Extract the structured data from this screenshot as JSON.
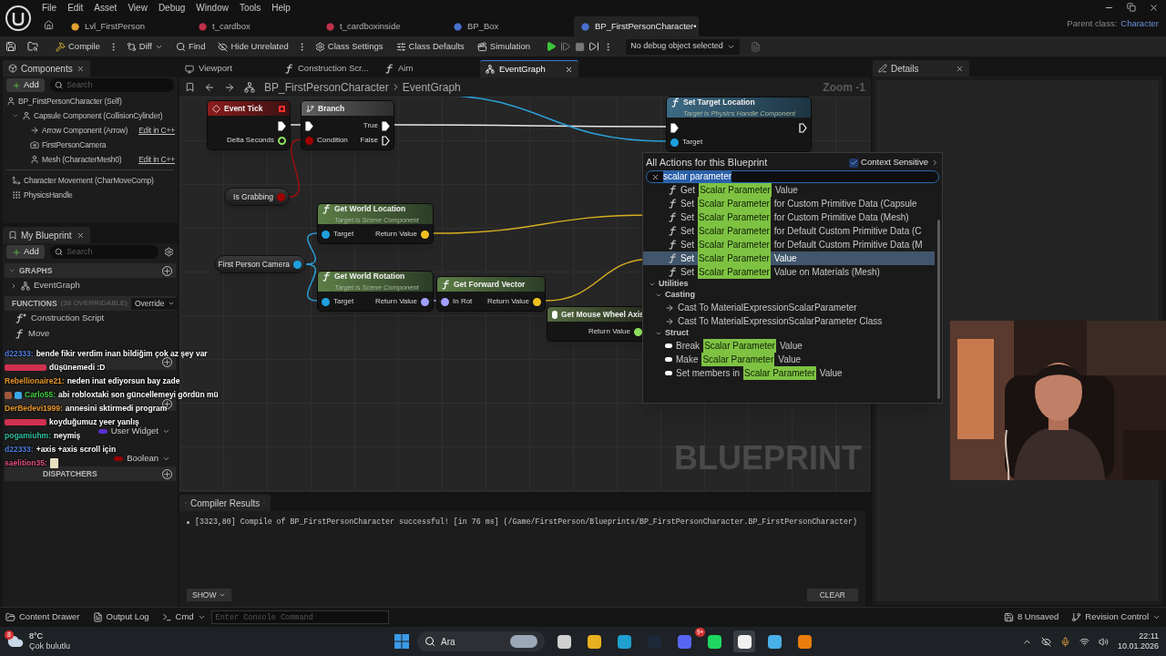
{
  "window": {
    "menu": [
      "File",
      "Edit",
      "Asset",
      "View",
      "Debug",
      "Window",
      "Tools",
      "Help"
    ],
    "tabs": [
      {
        "label": "Lvl_FirstPerson",
        "kind": "level",
        "selected": false
      },
      {
        "label": "t_cardbox",
        "kind": "texture",
        "selected": false
      },
      {
        "label": "t_cardboxinside",
        "kind": "texture",
        "selected": false
      },
      {
        "label": "BP_Box",
        "kind": "blueprint",
        "selected": false
      },
      {
        "label": "BP_FirstPersonCharacter•",
        "kind": "blueprint",
        "selected": true
      }
    ],
    "parent_class_label": "Parent class:",
    "parent_class": "Character"
  },
  "toolbar": [
    {
      "kind": "compile",
      "label": "Compile"
    },
    {
      "kind": "diff",
      "label": "Diff"
    },
    {
      "kind": "find",
      "label": "Find"
    },
    {
      "kind": "hide",
      "label": "Hide Unrelated"
    },
    {
      "kind": "settings",
      "label": "Class Settings"
    },
    {
      "kind": "defaults",
      "label": "Class Defaults"
    },
    {
      "kind": "simulation",
      "label": "Simulation"
    }
  ],
  "debug_object": "No debug object selected",
  "editor_tabs": [
    {
      "label": "Viewport",
      "kind": "viewport",
      "selected": false
    },
    {
      "label": "Construction Scr...",
      "kind": "function",
      "selected": false
    },
    {
      "label": "Aim",
      "kind": "function",
      "selected": false
    },
    {
      "label": "EventGraph",
      "kind": "graph",
      "selected": true
    }
  ],
  "components": {
    "title": "Components",
    "add": "Add",
    "search_placeholder": "Search",
    "tree": [
      {
        "label": "BP_FirstPersonCharacter (Self)",
        "kind": "self",
        "children": [
          {
            "label": "Capsule Component (CollisionCylinder)",
            "kind": "capsule",
            "children": [
              {
                "label": "Arrow Component (Arrow)",
                "kind": "arrow",
                "link": "Edit in C++"
              },
              {
                "label": "FirstPersonCamera",
                "kind": "camera"
              },
              {
                "label": "Mesh (CharacterMesh0)",
                "kind": "mesh",
                "link": "Edit in C++"
              }
            ]
          }
        ]
      }
    ],
    "other": [
      {
        "label": "Character Movement (CharMoveComp)",
        "kind": "movement"
      },
      {
        "label": "PhysicsHandle",
        "kind": "handle"
      }
    ]
  },
  "my_blueprint": {
    "title": "My Blueprint",
    "add": "Add",
    "search_placeholder": "Search",
    "graphs": {
      "title": "GRAPHS",
      "items": [
        "EventGraph"
      ]
    },
    "functions": {
      "title": "FUNCTIONS",
      "note": "(38 OVERRIDABLE)",
      "override": "Override",
      "items": [
        {
          "label": "Construction Script",
          "kind": "construction"
        },
        {
          "label": "Move",
          "kind": "function"
        }
      ]
    },
    "variables": [
      {
        "type": "User Widget",
        "color": "#5a2fd0"
      },
      {
        "type": "Boolean",
        "color": "#950000"
      }
    ],
    "dispatchers_title": "DISPATCHERS"
  },
  "graph": {
    "breadcrumb": [
      "BP_FirstPersonCharacter",
      "EventGraph"
    ],
    "zoom": "Zoom -1",
    "watermark": "BLUEPRINT",
    "nodes": [
      {
        "kind": "event",
        "title": "Event Tick",
        "outputs": [
          {
            "kind": "exec",
            "linked": true
          },
          {
            "kind": "data",
            "color": "#90e060",
            "label": "Delta Seconds",
            "linked": false
          }
        ]
      },
      {
        "kind": "branch",
        "title": "Branch",
        "inputs": [
          {
            "kind": "exec",
            "linked": true
          },
          {
            "kind": "data",
            "color": "#a00000",
            "label": "Condition",
            "linked": true
          }
        ],
        "outputs": [
          {
            "kind": "exec",
            "label": "True",
            "linked": true
          },
          {
            "kind": "exec",
            "label": "False",
            "linked": false
          }
        ]
      },
      {
        "kind": "variable",
        "title": "Is Grabbing",
        "outputs": [
          {
            "kind": "data",
            "color": "#a00000",
            "linked": true
          }
        ]
      },
      {
        "kind": "pure_function",
        "title": "Get World Location",
        "subtitle": "Target is Scene Component",
        "inputs": [
          {
            "kind": "data",
            "color": "#1ea0e0",
            "label": "Target",
            "linked": true
          }
        ],
        "outputs": [
          {
            "kind": "data",
            "color": "#f0c020",
            "label": "Return Value",
            "linked": true
          }
        ]
      },
      {
        "kind": "variable",
        "title": "First Person Camera",
        "outputs": [
          {
            "kind": "data",
            "color": "#1ea0e0",
            "linked": true
          }
        ]
      },
      {
        "kind": "pure_function",
        "title": "Get World Rotation",
        "subtitle": "Target is Scene Component",
        "inputs": [
          {
            "kind": "data",
            "color": "#1ea0e0",
            "label": "Target",
            "linked": true
          }
        ],
        "outputs": [
          {
            "kind": "data",
            "color": "#a0a0ff",
            "label": "Return Value",
            "linked": true
          }
        ]
      },
      {
        "kind": "pure_function",
        "title": "Get Forward Vector",
        "inputs": [
          {
            "kind": "data",
            "color": "#a0a0ff",
            "label": "In Rot",
            "linked": true
          }
        ],
        "outputs": [
          {
            "kind": "data",
            "color": "#f0c020",
            "label": "Return Value",
            "linked": true
          }
        ]
      },
      {
        "kind": "input",
        "title": "Get Mouse Wheel Axis",
        "outputs": [
          {
            "kind": "data",
            "color": "#90e060",
            "label": "Return Value",
            "linked": true
          }
        ]
      },
      {
        "kind": "function",
        "title": "Set Target Location",
        "subtitle": "Target is Physics Handle Component",
        "inputs": [
          {
            "kind": "exec",
            "linked": true
          },
          {
            "kind": "data",
            "color": "#1ea0e0",
            "label": "Target",
            "linked": true
          }
        ],
        "outputs": [
          {
            "kind": "exec",
            "linked": false
          }
        ]
      }
    ]
  },
  "action_menu": {
    "title": "All Actions for this Blueprint",
    "context_sensitive": {
      "label": "Context Sensitive",
      "checked": true
    },
    "search": "scalar parameter",
    "items": [
      {
        "kind": "function",
        "prefix": "Get",
        "match": "Scalar Parameter",
        "suffix": "Value",
        "selected": false
      },
      {
        "kind": "function",
        "prefix": "Set",
        "match": "Scalar Parameter",
        "suffix": "for Custom Primitive Data (Capsule",
        "selected": false
      },
      {
        "kind": "function",
        "prefix": "Set",
        "match": "Scalar Parameter",
        "suffix": "for Custom Primitive Data (Mesh)",
        "selected": false
      },
      {
        "kind": "function",
        "prefix": "Set",
        "match": "Scalar Parameter",
        "suffix": "for Default Custom Primitive Data (C",
        "selected": false
      },
      {
        "kind": "function",
        "prefix": "Set",
        "match": "Scalar Parameter",
        "suffix": "for Default Custom Primitive Data (M",
        "selected": false
      },
      {
        "kind": "function",
        "prefix": "Set",
        "match": "Scalar Parameter",
        "suffix": "Value",
        "selected": true
      },
      {
        "kind": "function",
        "prefix": "Set",
        "match": "Scalar Parameter",
        "suffix": "Value on Materials (Mesh)",
        "selected": false
      }
    ],
    "categories": [
      {
        "label": "Utilities",
        "children": [
          {
            "label": "Casting",
            "items": [
              {
                "kind": "cast",
                "prefix": "Cast To MaterialExpressionScalarParameter",
                "selected": false
              },
              {
                "kind": "cast",
                "prefix": "Cast To MaterialExpressionScalarParameter Class",
                "selected": false
              }
            ]
          },
          {
            "label": "Struct",
            "items": [
              {
                "kind": "struct",
                "prefix": "Break",
                "match": "Scalar Parameter",
                "suffix": "Value",
                "selected": false
              },
              {
                "kind": "struct",
                "prefix": "Make",
                "match": "Scalar Parameter",
                "suffix": "Value",
                "selected": false
              },
              {
                "kind": "struct",
                "prefix": "Set members in",
                "match": "Scalar Parameter",
                "suffix": "Value",
                "selected": false
              }
            ]
          }
        ]
      }
    ]
  },
  "details": {
    "title": "Details"
  },
  "compiler": {
    "title": "Compiler Results",
    "messages": [
      "[3323,80] Compile of BP_FirstPersonCharacter successful! [in 76 ms] (/Game/FirstPerson/Blueprints/BP_FirstPersonCharacter.BP_FirstPersonCharacter)"
    ],
    "show": "SHOW",
    "clear": "CLEAR"
  },
  "chat": [
    {
      "user": "d22333:",
      "color": "#4f7fe0",
      "text": "bende fikir verdim inan bildiğim çok az şey var"
    },
    {
      "color": "#d03050",
      "text": "düşünemedi :D"
    },
    {
      "user": "Rebellionaire21:",
      "color": "#e8962a",
      "text": "neden inat ediyorsun bay zade"
    },
    {
      "user": "Carlo55:",
      "color": "#40d040",
      "text": "abi robloxtaki son güncellemeyi gördün mü",
      "badges": [
        {
          "kind": "cookie"
        },
        {
          "kind": "cube"
        }
      ]
    },
    {
      "user": "DerBedevi1999:",
      "color": "#e8962a",
      "text": "annesini sktirmedi program"
    },
    {
      "color": "#d03050",
      "text": "koyduğumuz yeer yanlış"
    },
    {
      "user": "pogamiuhm:",
      "color": "#30c0a0",
      "text": "neymiş"
    },
    {
      "user": "d22333:",
      "color": "#4f7fe0",
      "text": "+axis +axis scroll için"
    },
    {
      "user": "saelition35:",
      "color": "#e05080",
      "emote": true
    }
  ],
  "status_bar": {
    "content_drawer": "Content Drawer",
    "output_log": "Output Log",
    "cmd": "Cmd",
    "console_placeholder": "Enter Console Command",
    "unsaved": "8 Unsaved",
    "revision_control": "Revision Control"
  },
  "taskbar": {
    "weather": {
      "temp": "8°C",
      "text": "Çok bulutlu",
      "badge": "8"
    },
    "search_placeholder": "Ara",
    "apps": [
      {
        "kind": "taskview",
        "active": false
      },
      {
        "kind": "explorer",
        "active": false
      },
      {
        "kind": "edge",
        "active": false
      },
      {
        "kind": "steam",
        "active": false
      },
      {
        "kind": "discord",
        "active": false,
        "badge": "9+"
      },
      {
        "kind": "spotify",
        "active": false
      },
      {
        "kind": "unreal",
        "active": true
      },
      {
        "kind": "app",
        "active": false
      },
      {
        "kind": "blender",
        "active": false
      }
    ],
    "time": "22:11",
    "date": "10.01.2026"
  }
}
